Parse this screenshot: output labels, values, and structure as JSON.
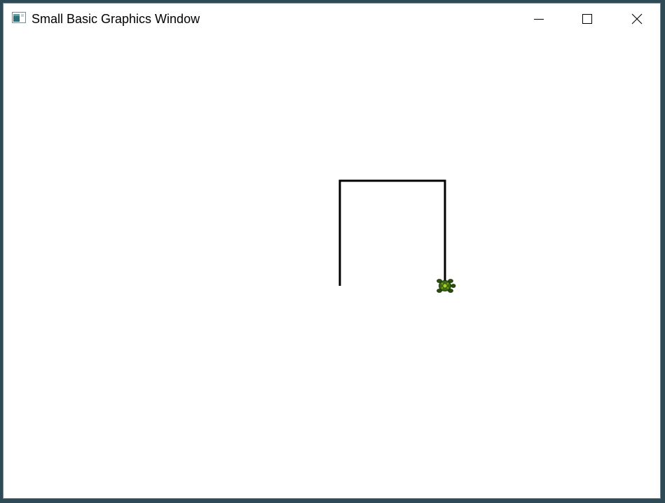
{
  "window": {
    "title": "Small Basic Graphics Window",
    "icon": "small-basic-app-icon",
    "controls": {
      "minimize_icon": "minimize-icon",
      "maximize_icon": "maximize-icon",
      "close_icon": "close-icon"
    }
  },
  "drawing": {
    "pen_color": "#000000",
    "turtle": {
      "icon": "turtle-icon",
      "shell_color": "#3a6b12",
      "body_color": "#2a4d0a"
    }
  }
}
